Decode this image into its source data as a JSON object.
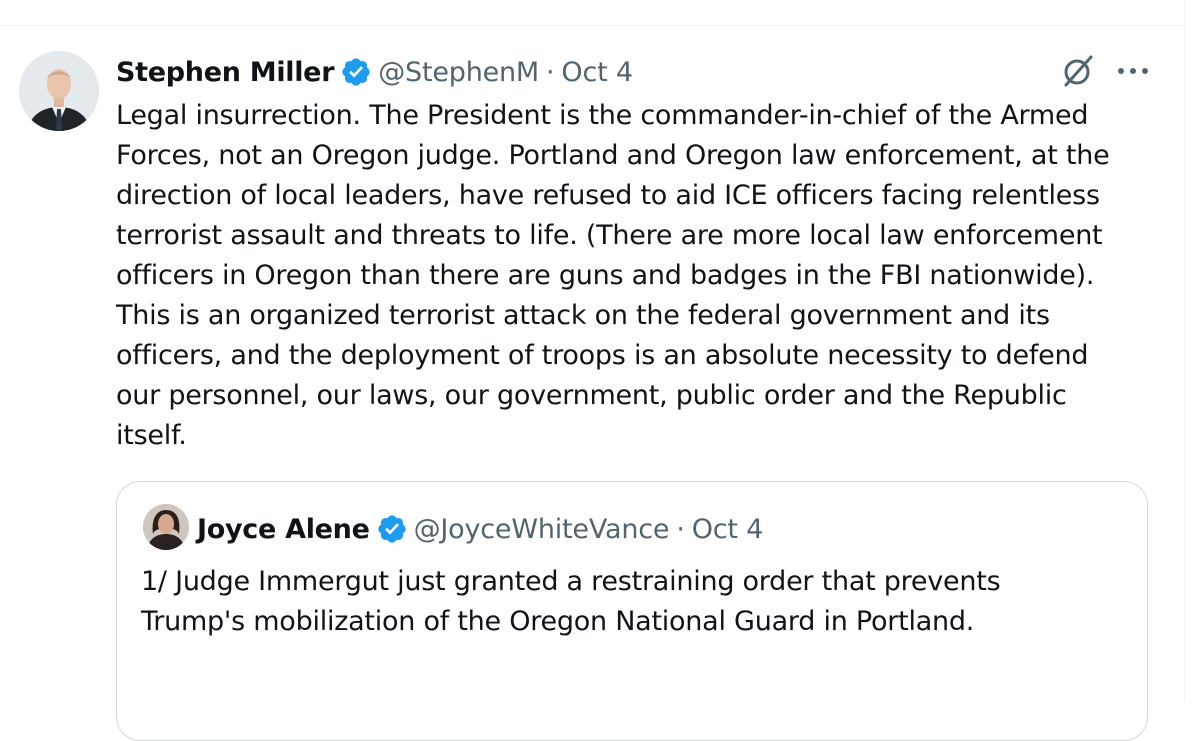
{
  "post": {
    "author_name": "Stephen Miller",
    "handle": "@StephenM",
    "separator": "·",
    "date": "Oct 4",
    "verified_color": "#1d9bf0",
    "text": "Legal insurrection. The President is the commander-in-chief of the Armed\nForces, not an Oregon judge. Portland and Oregon law enforcement, at the\ndirection of local leaders, have refused to aid ICE officers facing relentless\nterrorist assault and threats to life. (There are more local law enforcement\nofficers in Oregon than there are guns and badges in the FBI nationwide).\nThis is an organized terrorist attack on the federal government and its\nofficers, and the deployment of troops is an absolute necessity to defend\nour personnel, our laws, our government, public order and the Republic\nitself.",
    "icons": [
      "grok-icon",
      "more-icon"
    ]
  },
  "quote": {
    "author_name": "Joyce Alene",
    "handle": "@JoyceWhiteVance",
    "separator": "·",
    "date": "Oct 4",
    "text": "1/ Judge Immergut just granted a restraining order that prevents\nTrump's mobilization of the Oregon National Guard in Portland."
  },
  "colors": {
    "text": "#0f1419",
    "secondary": "#536471",
    "border": "#cfd9de",
    "accent": "#1d9bf0"
  }
}
